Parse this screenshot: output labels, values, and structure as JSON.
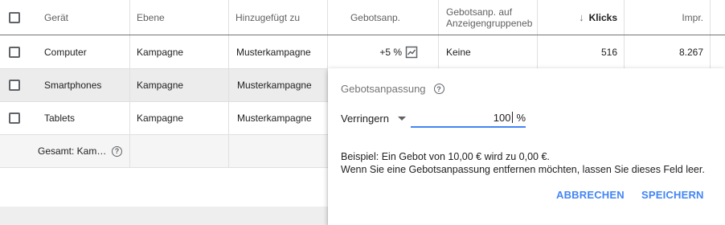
{
  "header": {
    "geraet": "Gerät",
    "ebene": "Ebene",
    "hinzugefuegt": "Hinzugefügt zu",
    "gebotsanp": "Gebotsanp.",
    "gebotsanp_auf": "Gebotsanp. auf Anzeigengruppeneb",
    "sort_arrow": "↓",
    "klicks": "Klicks",
    "impr": "Impr."
  },
  "rows": [
    {
      "geraet": "Computer",
      "ebene": "Kampagne",
      "hinzugefuegt": "Musterkampagne",
      "gebotsanp": "+5 %",
      "gebotsanp_auf": "Keine",
      "klicks": "516",
      "impr": "8.267"
    },
    {
      "geraet": "Smartphones",
      "ebene": "Kampagne",
      "hinzugefuegt": "Musterkampagne"
    },
    {
      "geraet": "Tablets",
      "ebene": "Kampagne",
      "hinzugefuegt": "Musterkampagne"
    }
  ],
  "total": {
    "label": "Gesamt: Kam…"
  },
  "popup": {
    "title": "Gebotsanpassung",
    "select_value": "Verringern",
    "input_value": "100",
    "input_unit": "%",
    "example_line1": "Beispiel: Ein Gebot von 10,00 € wird zu 0,00 €.",
    "example_line2": "Wenn Sie eine Gebotsanpassung entfernen möchten, lassen Sie dieses Feld leer.",
    "cancel": "ABBRECHEN",
    "save": "SPEICHERN"
  },
  "colors": {
    "accent": "#4285f4",
    "selected_row": "#ececec"
  },
  "icons": {
    "help": "help-circle-icon",
    "trend": "trend-chart-icon",
    "sort": "arrow-down-icon",
    "dropdown": "dropdown-caret-icon"
  }
}
